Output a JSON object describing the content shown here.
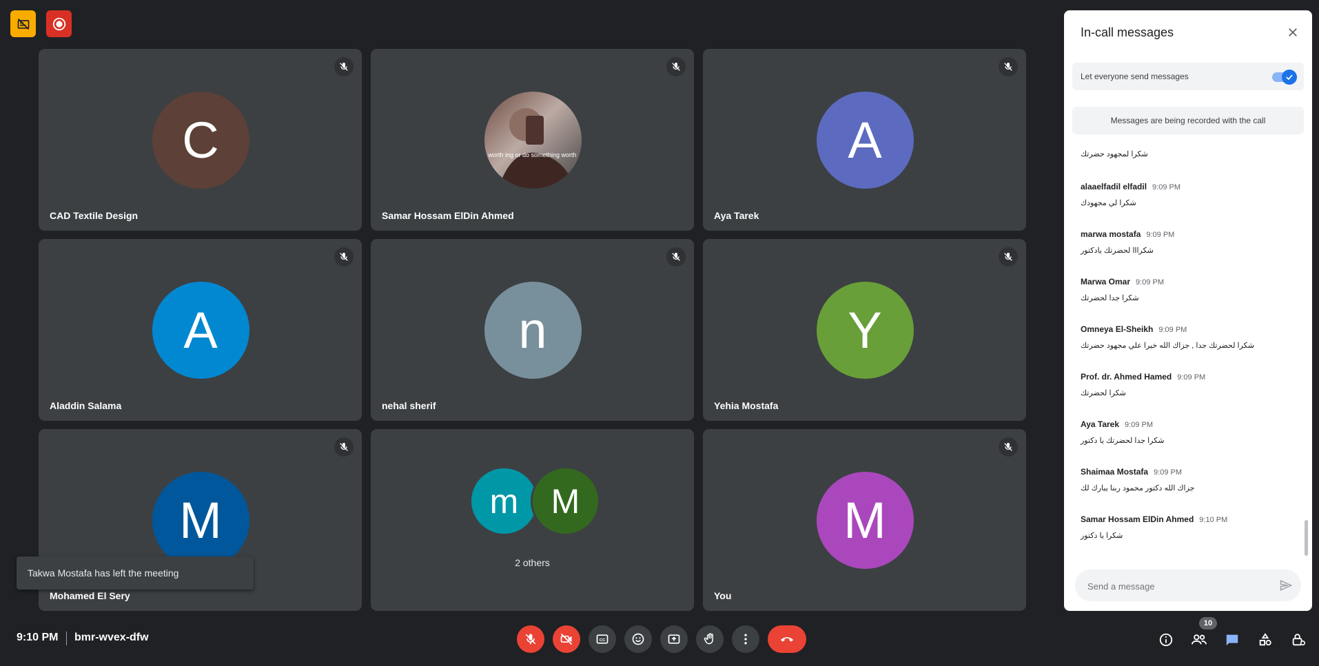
{
  "meeting": {
    "time": "9:10 PM",
    "code": "bmr-wvex-dfw",
    "participant_count": "10"
  },
  "tiles": [
    {
      "name": "CAD Textile Design",
      "initial": "C",
      "color": "#5d4037"
    },
    {
      "name": "Samar Hossam ElDin Ahmed",
      "initial": "",
      "color": "#e0e0e0"
    },
    {
      "name": "Aya Tarek",
      "initial": "A",
      "color": "#5c6bc0"
    },
    {
      "name": "Aladdin Salama",
      "initial": "A",
      "color": "#0288d1"
    },
    {
      "name": "nehal sherif",
      "initial": "n",
      "color": "#78909c"
    },
    {
      "name": "Yehia Mostafa",
      "initial": "Y",
      "color": "#689f38"
    },
    {
      "name": "Mohamed El Sery",
      "initial": "M",
      "color": "#01579b"
    },
    {
      "name": "2 others",
      "initial": "",
      "color": ""
    },
    {
      "name": "You",
      "initial": "M",
      "color": "#ab47bc"
    }
  ],
  "others": {
    "first_initial": "m",
    "first_color": "#0097a7",
    "second_initial": "M",
    "second_color": "#33691e"
  },
  "photo_text": "ther write something worth ing or do something worth ... Benjamin Franklin",
  "toast": "Takwa Mostafa has left the meeting",
  "chat": {
    "title": "In-call messages",
    "toggle_label": "Let everyone send messages",
    "recorded_notice": "Messages are being recorded with the call",
    "partial_first": "شكرا لمجهود حضرتك",
    "messages": [
      {
        "sender": "alaaelfadil elfadil",
        "time": "9:09 PM",
        "text": "شكرا لي مجهودك"
      },
      {
        "sender": "marwa mostafa",
        "time": "9:09 PM",
        "text": "شكرااا لحضرتك يادكتور"
      },
      {
        "sender": "Marwa Omar",
        "time": "9:09 PM",
        "text": "شكرا جدا لحضرتك"
      },
      {
        "sender": "Omneya El-Sheikh",
        "time": "9:09 PM",
        "text": "شكرا لحضرتك جدا , جزاك الله خيرا علي مجهود حضرتك"
      },
      {
        "sender": "Prof. dr. Ahmed Hamed",
        "time": "9:09 PM",
        "text": "شكرا لحضرتك"
      },
      {
        "sender": "Aya Tarek",
        "time": "9:09 PM",
        "text": "شكرا جدا لحضرتك يا دكتور"
      },
      {
        "sender": "Shaimaa Mostafa",
        "time": "9:09 PM",
        "text": "جزاك الله دكتور محمود ربنا يبارك لك"
      },
      {
        "sender": "Samar Hossam ElDin Ahmed",
        "time": "9:10 PM",
        "text": "شكرا يا دكتور"
      }
    ],
    "input_placeholder": "Send a message"
  },
  "colors": {
    "background": "#202124",
    "tile": "#3c4043",
    "danger": "#ea4335",
    "accent": "#1a73e8",
    "warning": "#f9ab00"
  }
}
